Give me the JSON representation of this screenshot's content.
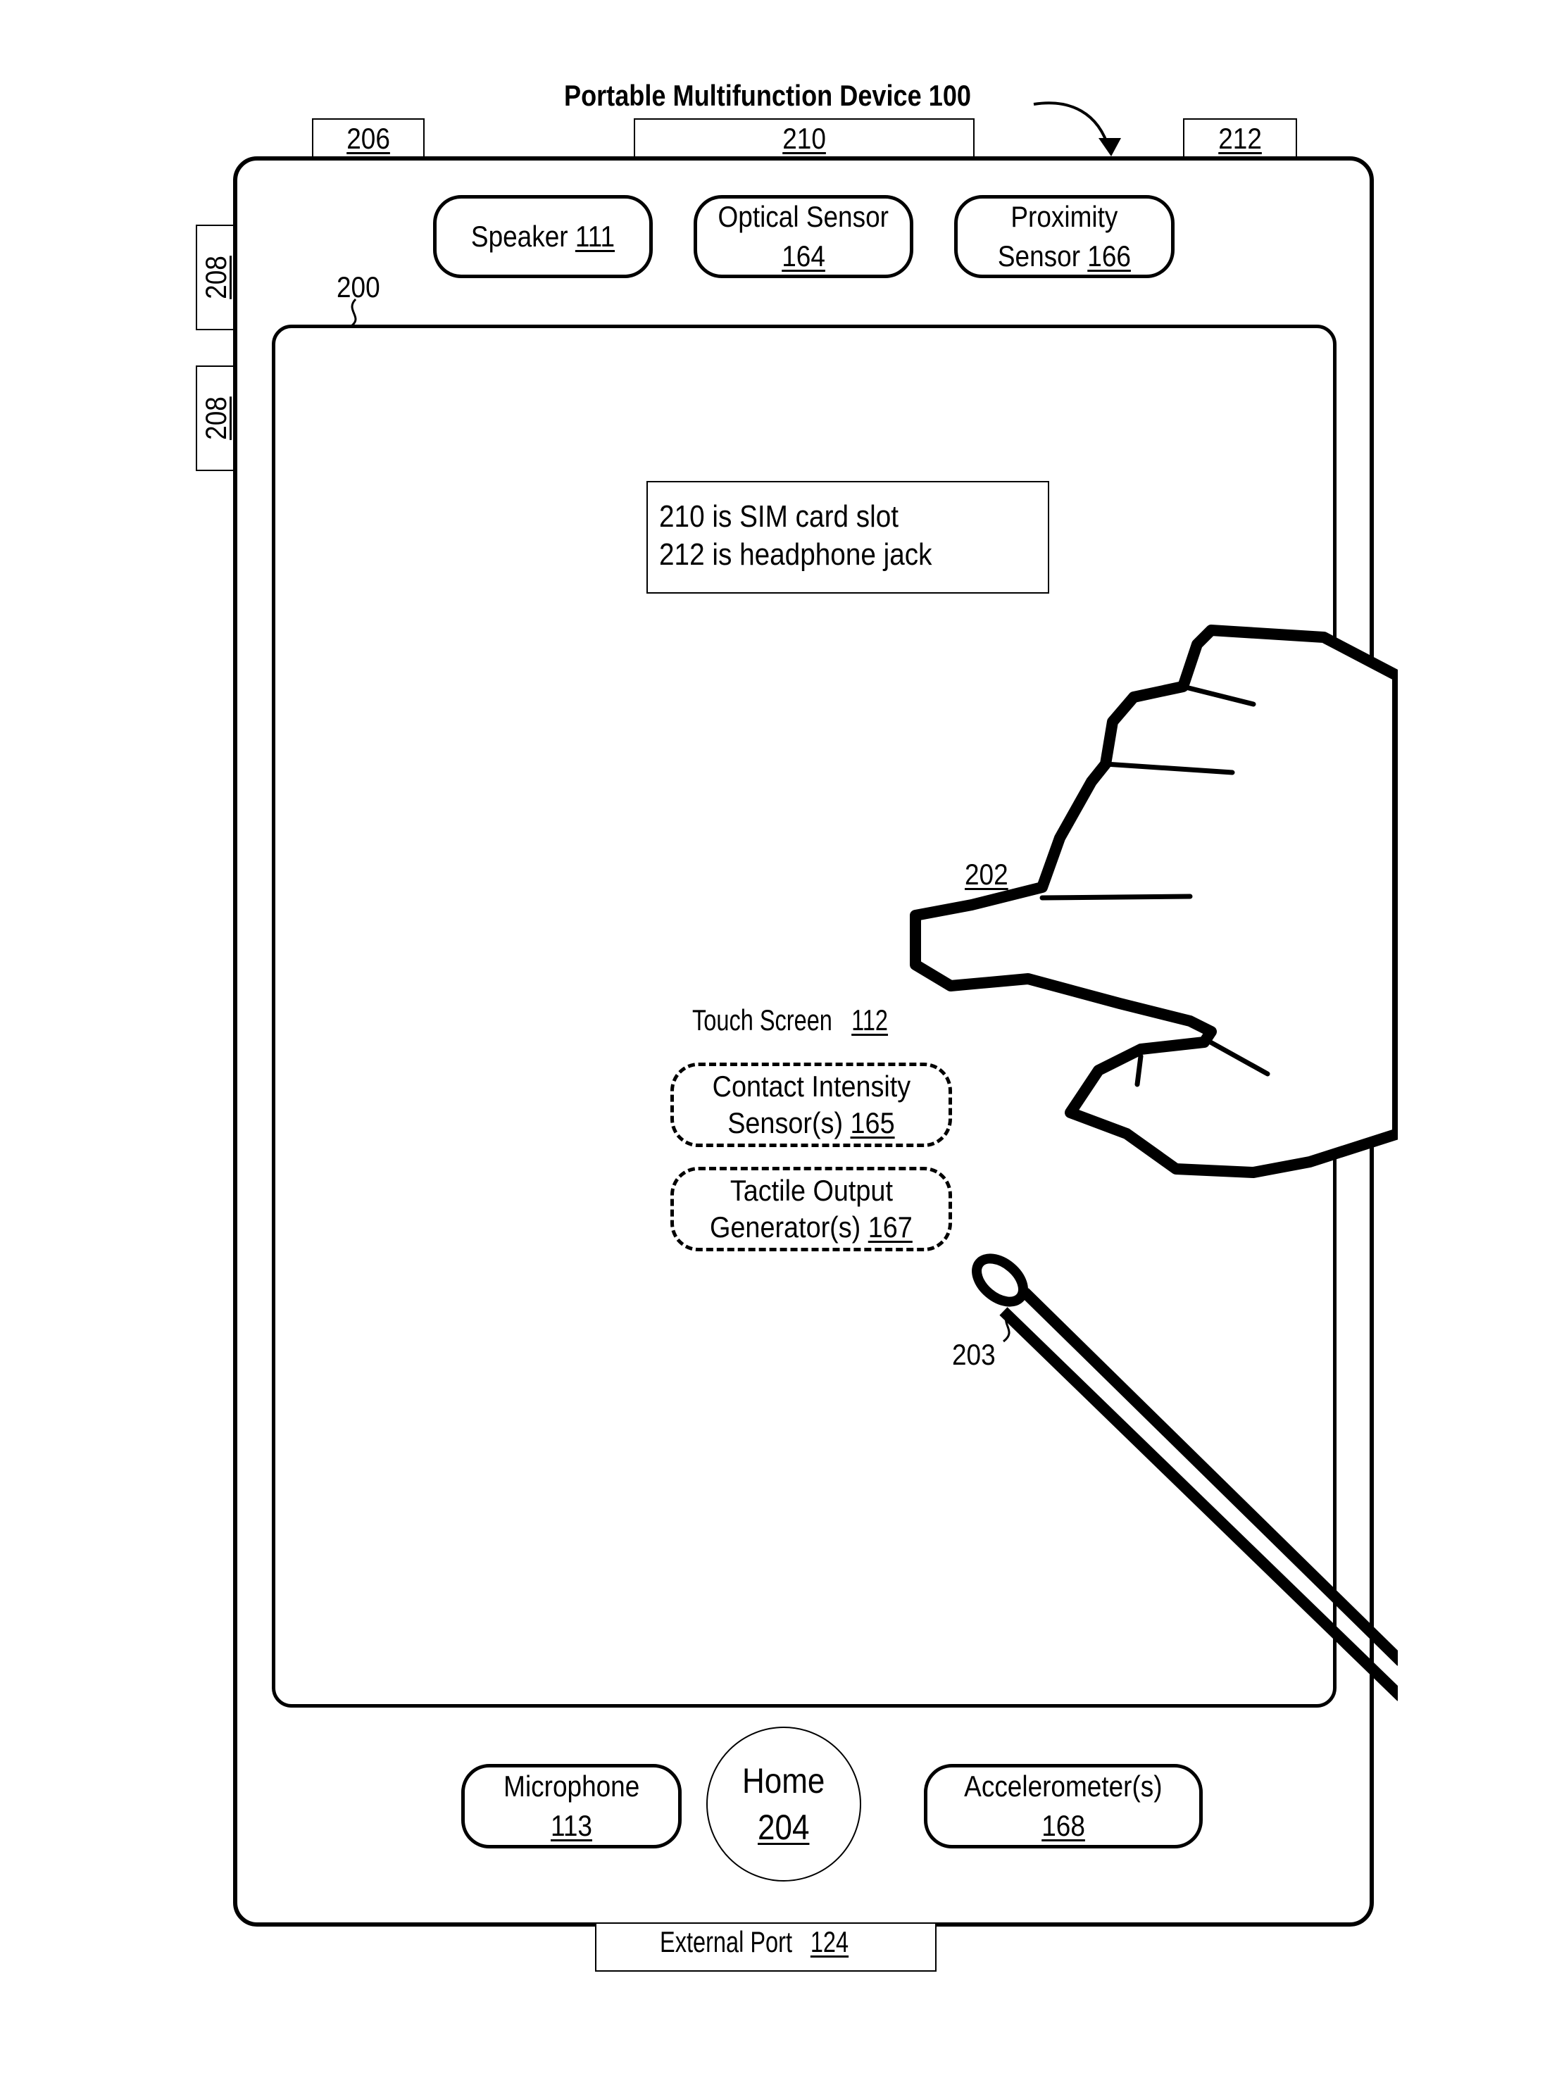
{
  "figure": {
    "title": "Portable Multifunction Device 100",
    "note_lines": [
      "210 is SIM card slot",
      "212 is headphone jack"
    ]
  },
  "ports": {
    "top_left": "206",
    "sim_slot": "210",
    "headphone_jack": "212",
    "side_button_1": "208",
    "side_button_2": "208",
    "external_port": {
      "text": "External Port ",
      "ref": "124"
    }
  },
  "top_components": [
    {
      "lines": [
        {
          "text": "Speaker ",
          "ref": "111"
        }
      ]
    },
    {
      "lines": [
        {
          "text": "Optical Sensor",
          "ref": ""
        },
        {
          "text": "",
          "ref": "164"
        }
      ]
    },
    {
      "lines": [
        {
          "text": "Proximity",
          "ref": ""
        },
        {
          "text": "Sensor ",
          "ref": "166"
        }
      ]
    }
  ],
  "screen": {
    "ref_label": "200",
    "title": {
      "text": "Touch Screen ",
      "ref": "112"
    },
    "sensors": [
      {
        "line1": "Contact Intensity",
        "line2_text": "Sensor(s) ",
        "line2_ref": "165"
      },
      {
        "line1": "Tactile Output",
        "line2_text": "Generator(s) ",
        "line2_ref": "167"
      }
    ],
    "finger_ref": "202",
    "stylus_ref": "203"
  },
  "bottom_components": {
    "microphone": {
      "line1": "Microphone",
      "ref": "113"
    },
    "home": {
      "line1": "Home",
      "ref": "204"
    },
    "accelerometer": {
      "line1": "Accelerometer(s)",
      "ref": "168"
    }
  }
}
